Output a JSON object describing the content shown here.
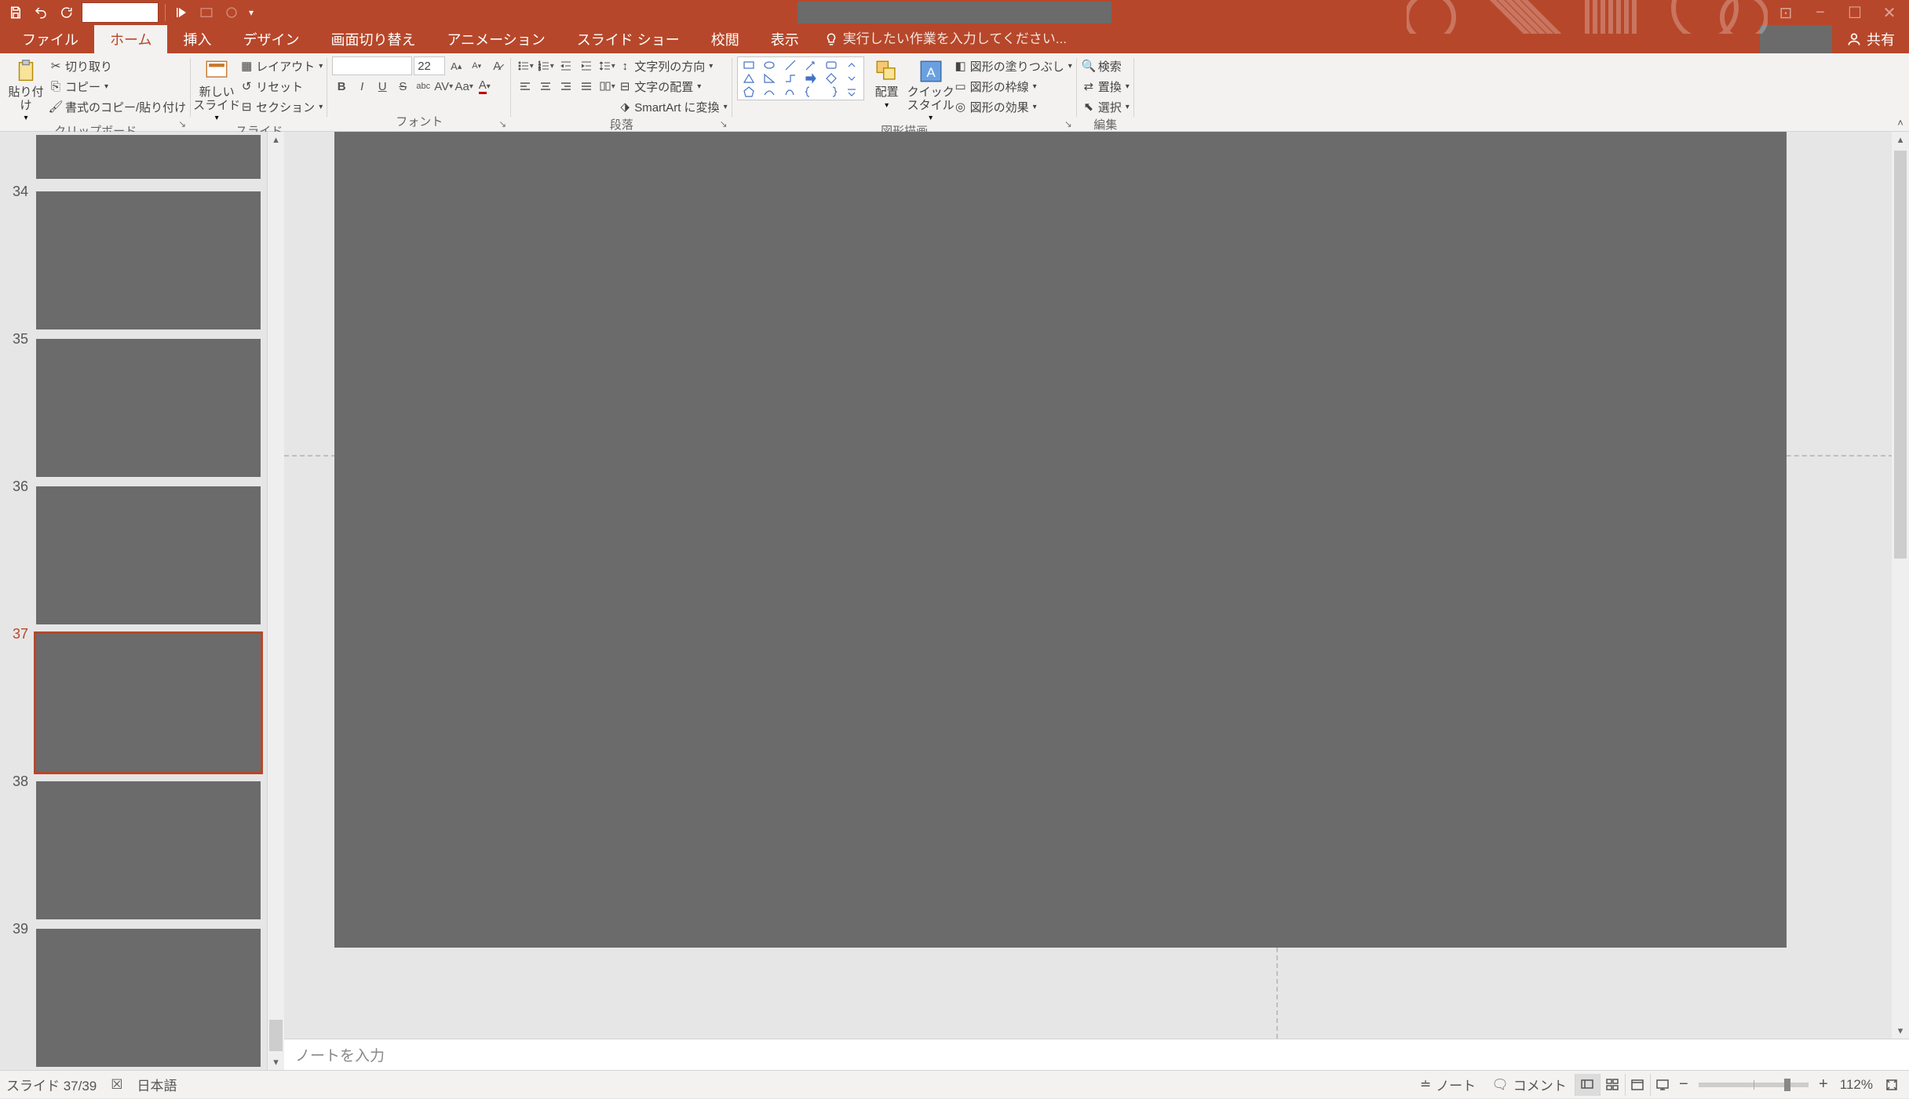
{
  "tabs": {
    "file": "ファイル",
    "home": "ホーム",
    "insert": "挿入",
    "design": "デザイン",
    "transitions": "画面切り替え",
    "animations": "アニメーション",
    "slideshow": "スライド ショー",
    "review": "校閲",
    "view": "表示"
  },
  "tell_me_placeholder": "実行したい作業を入力してください...",
  "share": "共有",
  "ribbon": {
    "clipboard": {
      "label": "クリップボード",
      "paste": "貼り付け",
      "cut": "切り取り",
      "copy": "コピー",
      "fmtpainter": "書式のコピー/貼り付け"
    },
    "slides": {
      "label": "スライド",
      "newslide": "新しい\nスライド",
      "layout": "レイアウト",
      "reset": "リセット",
      "section": "セクション"
    },
    "font": {
      "label": "フォント",
      "size": "22"
    },
    "paragraph": {
      "label": "段落",
      "textdir": "文字列の方向",
      "align": "文字の配置",
      "smartart": "SmartArt に変換"
    },
    "drawing": {
      "label": "図形描画",
      "arrange": "配置",
      "quickstyle": "クイック\nスタイル",
      "shapefill": "図形の塗りつぶし",
      "shapeoutline": "図形の枠線",
      "shapeeffects": "図形の効果"
    },
    "editing": {
      "label": "編集",
      "find": "検索",
      "replace": "置換",
      "select": "選択"
    }
  },
  "thumbnails": {
    "visible": [
      "34",
      "35",
      "36",
      "37",
      "38",
      "39"
    ],
    "selected": "37"
  },
  "notes_placeholder": "ノートを入力",
  "status": {
    "slide": "スライド 37/39",
    "lang": "日本語",
    "notes": "ノート",
    "comments": "コメント",
    "zoom": "112%"
  }
}
